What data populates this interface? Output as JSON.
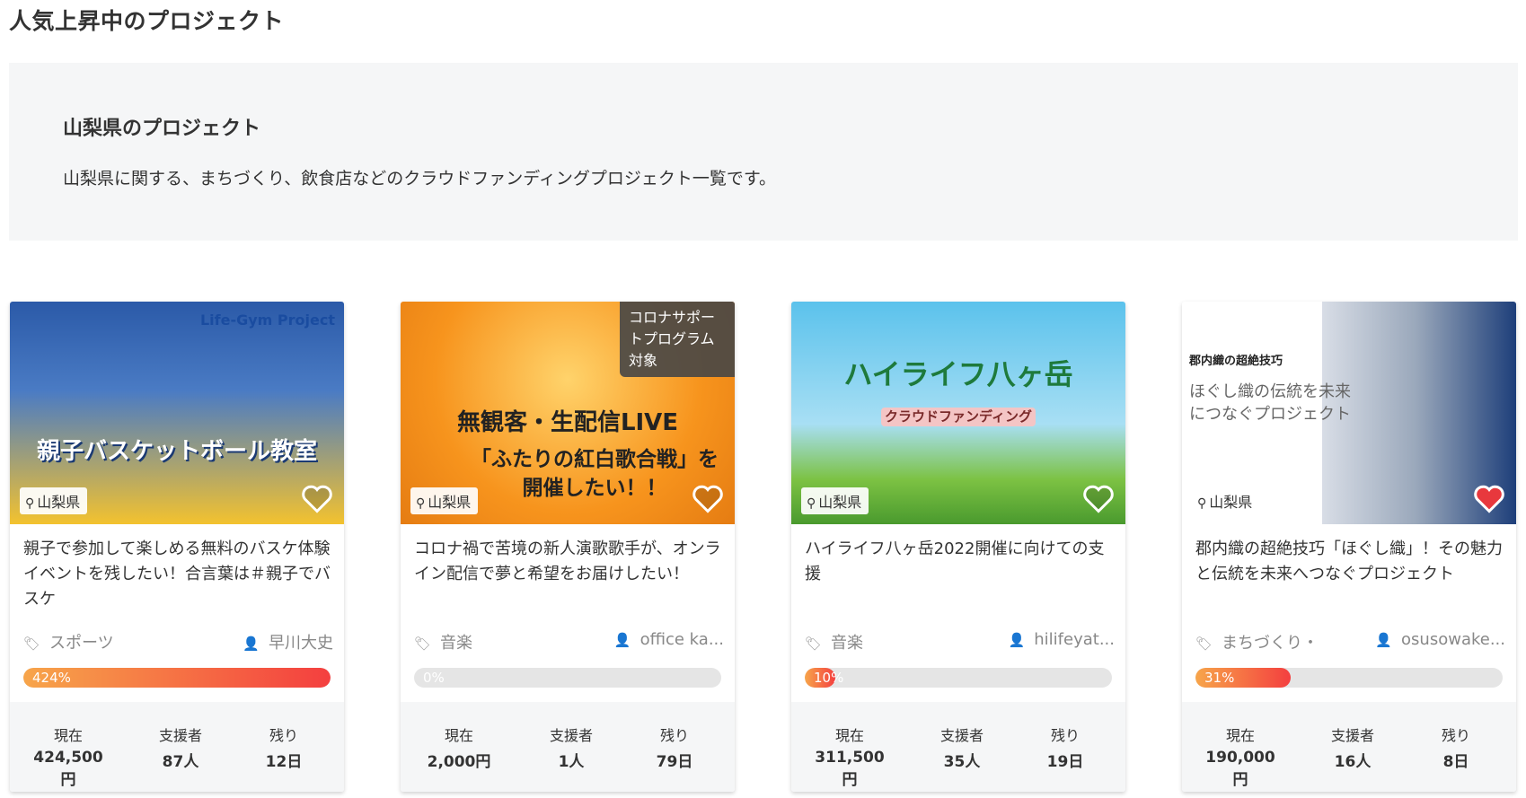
{
  "section_title": "人気上昇中のプロジェクト",
  "intro": {
    "heading": "山梨県のプロジェクト",
    "description": "山梨県に関する、まちづくり、飲食店などのクラウドファンディングプロジェクト一覧です。"
  },
  "stat_labels": {
    "current": "現在",
    "backers": "支援者",
    "remaining": "残り"
  },
  "cards": [
    {
      "thumb_title": "親子バスケットボール教室",
      "thumb_sub": "Life-Gym Project",
      "badge": "",
      "location": "山梨県",
      "title": "親子で参加して楽しめる無料のバスケ体験イベントを残したい！合言葉は＃親子でバスケ",
      "category": "スポーツ",
      "owner": "早川大史",
      "progress_label": "424%",
      "progress": 1.0,
      "current": "424,500円",
      "backers": "87人",
      "remaining": "12日",
      "favorited": false,
      "colors": {
        "bg1": "#2b5aa8",
        "bg2": "#f3c22f"
      }
    },
    {
      "thumb_title": "無観客・生配信LIVE",
      "thumb_sub": "「ふたりの紅白歌合戦」を開催したい！！",
      "badge": "コロナサポートプログラム対象",
      "location": "山梨県",
      "title": "コロナ禍で苦境の新人演歌歌手が、オンライン配信で夢と希望をお届けしたい！",
      "category": "音楽",
      "owner": "office ka...",
      "progress_label": "0%",
      "progress": 0.0,
      "current": "2,000円",
      "backers": "1人",
      "remaining": "79日",
      "favorited": false,
      "colors": {
        "bg1": "#f7941d",
        "bg2": "#f9b233"
      }
    },
    {
      "thumb_title": "ハイライフ八ヶ岳",
      "thumb_sub": "クラウドファンディング",
      "badge": "",
      "location": "山梨県",
      "title": "ハイライフ八ヶ岳2022開催に向けての支援",
      "category": "音楽",
      "owner": "hilifeyat...",
      "progress_label": "10%",
      "progress": 0.1,
      "current": "311,500円",
      "backers": "35人",
      "remaining": "19日",
      "favorited": false,
      "colors": {
        "bg1": "#5bc2ec",
        "bg2": "#7cc243"
      }
    },
    {
      "thumb_title": "郡内織の超絶技巧",
      "thumb_sub": "ほぐし織の伝統を未来につなぐプロジェクト",
      "badge": "",
      "location": "山梨県",
      "title": "郡内織の超絶技巧「ほぐし織」！その魅力と伝統を未来へつなぐプロジェクト",
      "category": "まちづくり・",
      "owner": "osusowake...",
      "progress_label": "31%",
      "progress": 0.31,
      "current": "190,000円",
      "backers": "16人",
      "remaining": "8日",
      "favorited": true,
      "colors": {
        "bg1": "#ffffff",
        "bg2": "#d8dde6"
      }
    }
  ]
}
